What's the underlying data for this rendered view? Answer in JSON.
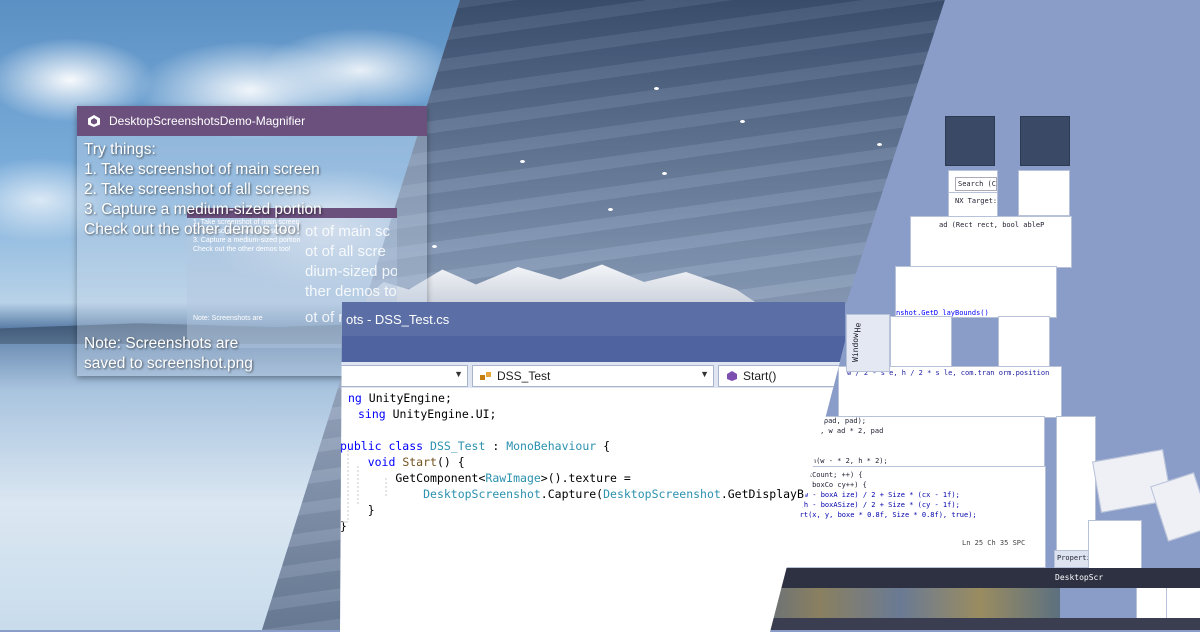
{
  "magnifier": {
    "title": "DesktopScreenshotsDemo-Magnifier",
    "intro": "Try things:",
    "steps": [
      "1. Take screenshot of main screen",
      "2. Take screenshot of all screens",
      "3. Capture a medium-sized portion"
    ],
    "hint": "Check out the other demos too!",
    "note_line1": "Note: Screenshots are",
    "note_line2": "saved to screenshot.png",
    "recursive_lines": [
      "1. Take screenshot of main screen",
      "2. Take screenshot of all screens",
      "3. Capture a medium-sized portion",
      "Check out the other demos too!"
    ],
    "recursive_note": "Note: Screenshots are",
    "recursive_big": [
      "ot of main sc",
      "ot of all scre",
      "dium-sized po",
      "ther demos to",
      "ot of main scr"
    ]
  },
  "ide": {
    "title": "ots - DSS_Test.cs",
    "nav_class": "DSS_Test",
    "nav_member": "Start()",
    "code_lines": [
      [
        {
          "t": "ng ",
          "c": "kw"
        },
        {
          "t": "UnityEngine;",
          "c": ""
        }
      ],
      [
        {
          "t": "sing ",
          "c": "kw"
        },
        {
          "t": "UnityEngine.UI;",
          "c": ""
        }
      ],
      [
        {
          "t": "",
          "c": ""
        }
      ],
      [
        {
          "t": "public class ",
          "c": "kw"
        },
        {
          "t": "DSS_Test",
          "c": "ty"
        },
        {
          "t": " : ",
          "c": ""
        },
        {
          "t": "MonoBehaviour",
          "c": "ty"
        },
        {
          "t": " {",
          "c": ""
        }
      ],
      [
        {
          "t": "    ",
          "c": ""
        },
        {
          "t": "void ",
          "c": "kw"
        },
        {
          "t": "Start",
          "c": "me"
        },
        {
          "t": "() {",
          "c": ""
        }
      ],
      [
        {
          "t": "        GetComponent<",
          "c": ""
        },
        {
          "t": "RawImage",
          "c": "ty"
        },
        {
          "t": ">().texture =",
          "c": ""
        }
      ],
      [
        {
          "t": "            ",
          "c": ""
        },
        {
          "t": "DesktopScreenshot",
          "c": "ty"
        },
        {
          "t": ".Capture(",
          "c": ""
        },
        {
          "t": "DesktopScreenshot",
          "c": "ty"
        },
        {
          "t": ".GetDisplayB",
          "c": ""
        }
      ],
      [
        {
          "t": "    }",
          "c": ""
        }
      ],
      [
        {
          "t": "}",
          "c": ""
        }
      ]
    ]
  },
  "right_panel": {
    "search_placeholder": "Search (Ctrl+",
    "nx_target": "NX Target:  D",
    "code_fragment": "ad (Rect rect, bool ableP",
    "status": "Ln 25   Ch 35      SPC",
    "properties_tab": "Properties",
    "taskbar_label": "DesktopScr",
    "tab_window": "Window",
    "tab_help": "He",
    "frag_bounds": "nshot.GetD     layBounds()",
    "frag_math": "w / 2 * s  e, h / 2 * s  le, com.tran   orm.position",
    "frag_pad": "w - pad, pad);",
    "frag_pad2": ", pad, w   ad * 2, pad",
    "frag_min": "t.Min(w - * 2, h    * 2);",
    "frag_loop1": "; boxCount; ++) {",
    "frag_loop2": " cy < boxCo  cy++) {",
    "frag_loop3": "p+ (w - boxA  ize) / 2 + Size * (cx - 1f);",
    "frag_loop4": "p+ (h - boxASize) / 2 + Size * (cy - 1f);",
    "frag_loop5": "nsert(x, y, boxe * 0.8f, Size * 0.8f), true);"
  },
  "colors": {
    "magnifier_title_bg": "#6b4f7d",
    "ide_title_bg": "#5b6fa6",
    "keyword": "#0000ff",
    "type": "#2b91af"
  }
}
